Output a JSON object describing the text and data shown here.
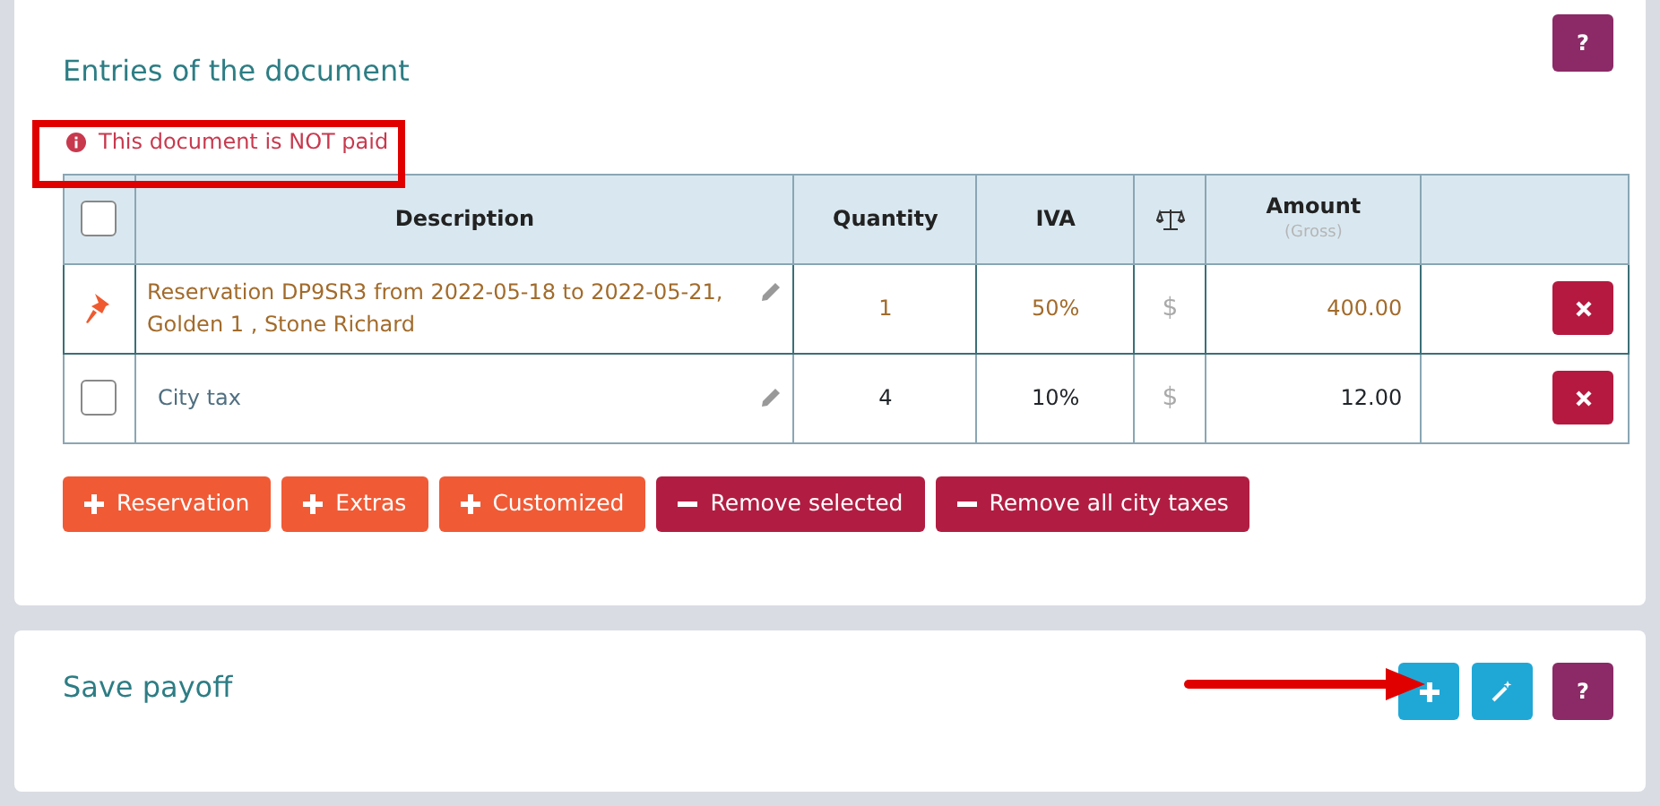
{
  "entries": {
    "title": "Entries of the document",
    "help": "?",
    "notice": "This document is NOT paid",
    "table": {
      "columns": [
        {
          "kind": "checkbox",
          "checked": false
        },
        {
          "kind": "text",
          "label": "Description"
        },
        {
          "kind": "text",
          "label": "Quantity"
        },
        {
          "kind": "text",
          "label": "IVA"
        },
        {
          "kind": "scale"
        },
        {
          "kind": "text",
          "label": "Amount",
          "sublabel": "(Gross)"
        },
        {
          "kind": "blank"
        }
      ],
      "rows": [
        {
          "kind": "pinned",
          "description": "Reservation DP9SR3 from 2022-05-18 to 2022-05-21, Golden 1 , Stone Richard",
          "quantity": "1",
          "iva": "50%",
          "currency": "$",
          "amount": "400.00"
        },
        {
          "kind": "checkbox",
          "checked": false,
          "description": "City tax",
          "quantity": "4",
          "iva": "10%",
          "currency": "$",
          "amount": "12.00"
        }
      ]
    },
    "actions": [
      {
        "kind": "add",
        "label": "Reservation"
      },
      {
        "kind": "add",
        "label": "Extras"
      },
      {
        "kind": "add",
        "label": "Customized"
      },
      {
        "kind": "remove",
        "label": "Remove selected"
      },
      {
        "kind": "remove",
        "label": "Remove all city taxes"
      }
    ]
  },
  "payoff": {
    "title": "Save payoff",
    "tools": [
      {
        "kind": "add"
      },
      {
        "kind": "wand"
      },
      {
        "kind": "help",
        "label": "?"
      }
    ]
  }
}
